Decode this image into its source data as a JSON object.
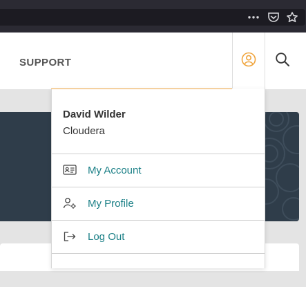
{
  "browser": {
    "toolbar_icons": [
      "more-icon",
      "pocket-icon",
      "bookmark-star-icon"
    ],
    "more_glyph": "•••"
  },
  "header": {
    "nav_support_label": "SUPPORT",
    "user_icon": "user-circle-icon",
    "search_icon": "search-icon"
  },
  "dropdown": {
    "user_name": "David Wilder",
    "organization": "Cloudera",
    "items": [
      {
        "label": "My Account",
        "icon": "id-card-icon"
      },
      {
        "label": "My Profile",
        "icon": "user-settings-icon"
      },
      {
        "label": "Log Out",
        "icon": "logout-icon"
      }
    ]
  },
  "colors": {
    "accent": "#f0a33a",
    "link": "#1a7f86",
    "hero": "#2f3d4a",
    "chrome": "#2b2a33"
  }
}
